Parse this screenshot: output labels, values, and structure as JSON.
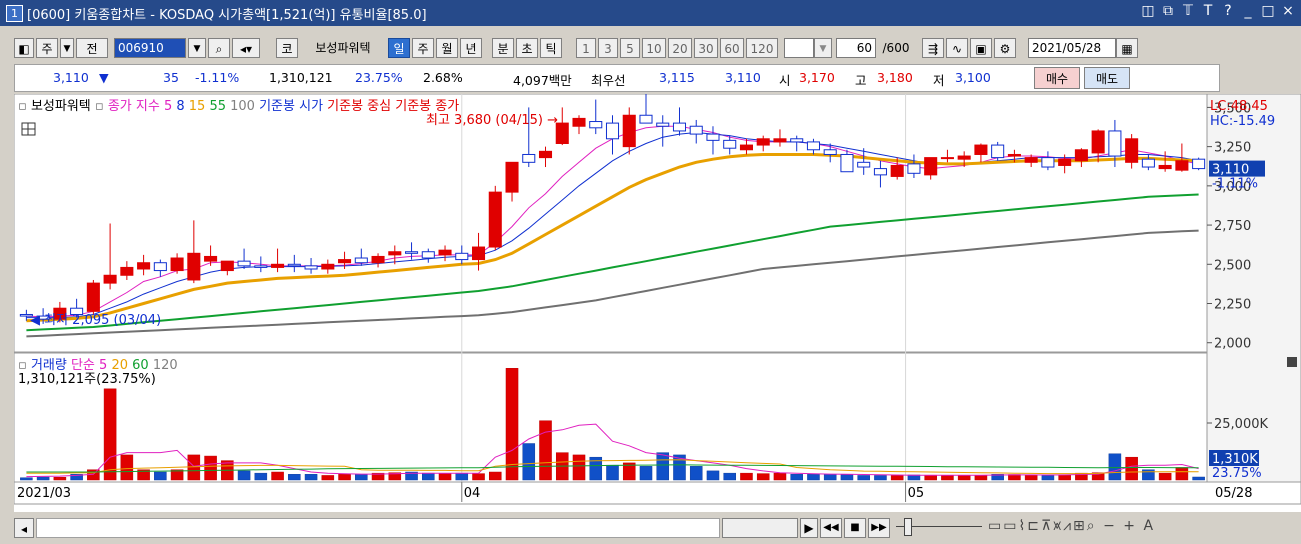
{
  "title": {
    "num": "1",
    "text": "[0600] 키움종합차트 - KOSDAQ 시가총액[1,521(억)] 유통비율[85.0]"
  },
  "window_controls": [
    "◫",
    "⧉",
    "𝕋",
    "T",
    "?",
    "_",
    "□",
    "×"
  ],
  "toolbar": {
    "ju": "주",
    "jeon": "전",
    "code": "006910",
    "ko": "코",
    "name": "보성파워텍",
    "period_buttons": [
      "일",
      "주",
      "월",
      "년",
      "분",
      "초",
      "틱"
    ],
    "num_buttons": [
      "1",
      "3",
      "5",
      "10",
      "20",
      "30",
      "60",
      "120"
    ],
    "count": "60",
    "total": "/600",
    "date": "2021/05/28"
  },
  "quote": {
    "price": "3,110",
    "arrow": "▼",
    "change": "35",
    "change_pct": "-1.11%",
    "volume": "1,310,121",
    "vol_ratio": "23.75%",
    "turnover": "2.68%",
    "amount": "4,097백만",
    "best_label": "최우선",
    "best_bid": "3,115",
    "best_ask": "3,110",
    "open_label": "시",
    "open": "3,170",
    "high_label": "고",
    "high": "3,180",
    "low_label": "저",
    "low": "3,100",
    "buy": "매수",
    "sell": "매도"
  },
  "chart_data": {
    "type": "candlestick",
    "legend_main": {
      "name": "보성파워텍",
      "items": [
        {
          "text": "종가 지수 5",
          "color": "#e020c0"
        },
        {
          "text": "8",
          "color": "#1030d0"
        },
        {
          "text": "15",
          "color": "#e8a000"
        },
        {
          "text": "55",
          "color": "#10a030"
        },
        {
          "text": "100",
          "color": "#808080"
        },
        {
          "text": "기준봉 시가",
          "color": "#1030d0"
        },
        {
          "text": "기준봉 중심",
          "color": "#e00000"
        },
        {
          "text": "기준봉 종가",
          "color": "#e00000"
        }
      ]
    },
    "y_ticks": [
      "3,500",
      "3,250",
      "3,000",
      "2,750",
      "2,500",
      "2,250",
      "2,000"
    ],
    "y_range": [
      1960,
      3560
    ],
    "lc": "LC:48.45",
    "hc": "HC:-15.49",
    "current_price": "3,110",
    "current_pct": "-1.11%",
    "high_annotation": "최고 3,680 (04/15) →",
    "low_annotation": "최저 2,095 (03/04)",
    "x_labels": [
      "2021/03",
      "04",
      "05",
      "05/28"
    ],
    "candles": [
      [
        2180,
        2210,
        2140,
        2170
      ],
      [
        2170,
        2220,
        2120,
        2150
      ],
      [
        2150,
        2260,
        2130,
        2220
      ],
      [
        2220,
        2280,
        2160,
        2180
      ],
      [
        2200,
        2400,
        2180,
        2380
      ],
      [
        2380,
        2760,
        2340,
        2430
      ],
      [
        2430,
        2520,
        2400,
        2480
      ],
      [
        2470,
        2560,
        2430,
        2510
      ],
      [
        2510,
        2530,
        2420,
        2460
      ],
      [
        2460,
        2570,
        2440,
        2540
      ],
      [
        2400,
        2780,
        2380,
        2570
      ],
      [
        2520,
        2620,
        2490,
        2550
      ],
      [
        2460,
        2520,
        2430,
        2520
      ],
      [
        2520,
        2600,
        2470,
        2490
      ],
      [
        2490,
        2550,
        2450,
        2480
      ],
      [
        2480,
        2600,
        2450,
        2500
      ],
      [
        2500,
        2560,
        2450,
        2490
      ],
      [
        2490,
        2540,
        2440,
        2470
      ],
      [
        2470,
        2530,
        2440,
        2500
      ],
      [
        2510,
        2580,
        2470,
        2530
      ],
      [
        2540,
        2600,
        2490,
        2510
      ],
      [
        2510,
        2570,
        2480,
        2550
      ],
      [
        2560,
        2620,
        2500,
        2580
      ],
      [
        2580,
        2640,
        2530,
        2570
      ],
      [
        2580,
        2600,
        2510,
        2540
      ],
      [
        2560,
        2620,
        2520,
        2590
      ],
      [
        2570,
        2620,
        2500,
        2530
      ],
      [
        2530,
        2700,
        2460,
        2610
      ],
      [
        2610,
        3000,
        2590,
        2960
      ],
      [
        2960,
        3150,
        2900,
        3150
      ],
      [
        3200,
        3500,
        3120,
        3150
      ],
      [
        3180,
        3250,
        3120,
        3220
      ],
      [
        3270,
        3500,
        3260,
        3400
      ],
      [
        3380,
        3450,
        3330,
        3430
      ],
      [
        3410,
        3550,
        3330,
        3370
      ],
      [
        3400,
        3450,
        3200,
        3300
      ],
      [
        3250,
        3500,
        3200,
        3450
      ],
      [
        3450,
        3600,
        3400,
        3400
      ],
      [
        3400,
        3450,
        3250,
        3380
      ],
      [
        3400,
        3500,
        3320,
        3350
      ],
      [
        3380,
        3420,
        3270,
        3330
      ],
      [
        3330,
        3380,
        3200,
        3290
      ],
      [
        3290,
        3320,
        3200,
        3240
      ],
      [
        3230,
        3300,
        3200,
        3260
      ],
      [
        3260,
        3320,
        3220,
        3300
      ],
      [
        3280,
        3360,
        3250,
        3300
      ],
      [
        3300,
        3320,
        3220,
        3280
      ],
      [
        3280,
        3300,
        3200,
        3230
      ],
      [
        3230,
        3270,
        3150,
        3200
      ],
      [
        3200,
        3230,
        3090,
        3090
      ],
      [
        3150,
        3240,
        3070,
        3120
      ],
      [
        3110,
        3160,
        2990,
        3070
      ],
      [
        3060,
        3180,
        3040,
        3130
      ],
      [
        3140,
        3200,
        3050,
        3080
      ],
      [
        3070,
        3180,
        3040,
        3180
      ],
      [
        3180,
        3230,
        3150,
        3180
      ],
      [
        3170,
        3220,
        3120,
        3190
      ],
      [
        3200,
        3270,
        3150,
        3260
      ],
      [
        3260,
        3280,
        3160,
        3180
      ],
      [
        3190,
        3230,
        3150,
        3200
      ],
      [
        3150,
        3200,
        3120,
        3180
      ],
      [
        3180,
        3220,
        3100,
        3120
      ],
      [
        3130,
        3200,
        3080,
        3170
      ],
      [
        3160,
        3240,
        3120,
        3230
      ],
      [
        3210,
        3360,
        3150,
        3350
      ],
      [
        3350,
        3420,
        3120,
        3190
      ],
      [
        3150,
        3330,
        3110,
        3300
      ],
      [
        3170,
        3200,
        3100,
        3120
      ],
      [
        3110,
        3220,
        3090,
        3130
      ],
      [
        3100,
        3270,
        3090,
        3160
      ],
      [
        3170,
        3180,
        3100,
        3110
      ]
    ],
    "ma_lines": [
      {
        "name": "5",
        "color": "#e020c0",
        "width": 1,
        "values": [
          2170,
          2165,
          2170,
          2175,
          2200,
          2260,
          2320,
          2390,
          2420,
          2460,
          2470,
          2510,
          2515,
          2510,
          2500,
          2490,
          2490,
          2490,
          2490,
          2495,
          2505,
          2520,
          2540,
          2550,
          2555,
          2560,
          2560,
          2560,
          2640,
          2740,
          2860,
          2950,
          3060,
          3150,
          3240,
          3300,
          3340,
          3370,
          3380,
          3380,
          3360,
          3340,
          3310,
          3290,
          3280,
          3280,
          3280,
          3270,
          3250,
          3220,
          3190,
          3160,
          3140,
          3120,
          3110,
          3120,
          3130,
          3150,
          3180,
          3190,
          3190,
          3185,
          3175,
          3170,
          3190,
          3210,
          3230,
          3210,
          3190,
          3160,
          3140
        ]
      },
      {
        "name": "8",
        "color": "#1030d0",
        "width": 1,
        "values": [
          2160,
          2160,
          2160,
          2165,
          2180,
          2220,
          2260,
          2310,
          2350,
          2390,
          2420,
          2450,
          2470,
          2480,
          2485,
          2485,
          2485,
          2485,
          2488,
          2490,
          2495,
          2505,
          2515,
          2525,
          2535,
          2545,
          2550,
          2555,
          2590,
          2650,
          2730,
          2820,
          2910,
          3000,
          3080,
          3160,
          3220,
          3270,
          3310,
          3330,
          3340,
          3330,
          3320,
          3300,
          3290,
          3280,
          3280,
          3270,
          3260,
          3240,
          3220,
          3200,
          3180,
          3160,
          3140,
          3140,
          3140,
          3150,
          3160,
          3170,
          3180,
          3180,
          3180,
          3180,
          3185,
          3190,
          3200,
          3200,
          3190,
          3180,
          3160
        ]
      },
      {
        "name": "15",
        "color": "#e8a000",
        "width": 3,
        "values": [
          2140,
          2145,
          2150,
          2155,
          2165,
          2190,
          2220,
          2250,
          2280,
          2310,
          2340,
          2360,
          2380,
          2390,
          2400,
          2410,
          2415,
          2420,
          2425,
          2430,
          2440,
          2450,
          2460,
          2470,
          2480,
          2490,
          2500,
          2505,
          2530,
          2570,
          2630,
          2690,
          2750,
          2810,
          2870,
          2930,
          2990,
          3040,
          3080,
          3120,
          3150,
          3170,
          3185,
          3195,
          3200,
          3200,
          3200,
          3200,
          3195,
          3190,
          3180,
          3170,
          3160,
          3150,
          3145,
          3140,
          3140,
          3145,
          3150,
          3155,
          3160,
          3160,
          3160,
          3160,
          3165,
          3170,
          3175,
          3175,
          3170,
          3165,
          3160
        ]
      },
      {
        "name": "55",
        "color": "#10a030",
        "width": 2,
        "values": [
          2080,
          2085,
          2090,
          2095,
          2100,
          2110,
          2120,
          2130,
          2140,
          2150,
          2160,
          2170,
          2180,
          2190,
          2200,
          2210,
          2220,
          2230,
          2240,
          2250,
          2260,
          2270,
          2280,
          2290,
          2300,
          2310,
          2320,
          2330,
          2345,
          2360,
          2380,
          2400,
          2420,
          2440,
          2460,
          2480,
          2500,
          2520,
          2540,
          2560,
          2580,
          2600,
          2620,
          2640,
          2660,
          2680,
          2700,
          2720,
          2740,
          2750,
          2760,
          2770,
          2780,
          2790,
          2800,
          2810,
          2820,
          2830,
          2840,
          2850,
          2860,
          2870,
          2880,
          2890,
          2900,
          2910,
          2920,
          2930,
          2935,
          2940,
          2945
        ]
      },
      {
        "name": "100",
        "color": "#707070",
        "width": 2,
        "values": [
          2040,
          2045,
          2050,
          2055,
          2060,
          2065,
          2070,
          2075,
          2080,
          2085,
          2090,
          2095,
          2100,
          2105,
          2110,
          2115,
          2120,
          2125,
          2130,
          2135,
          2140,
          2145,
          2150,
          2155,
          2160,
          2165,
          2170,
          2175,
          2185,
          2195,
          2210,
          2225,
          2240,
          2255,
          2270,
          2290,
          2310,
          2330,
          2350,
          2370,
          2390,
          2410,
          2430,
          2450,
          2470,
          2480,
          2490,
          2500,
          2510,
          2520,
          2530,
          2540,
          2550,
          2560,
          2570,
          2580,
          2590,
          2600,
          2610,
          2620,
          2630,
          2640,
          2650,
          2660,
          2670,
          2680,
          2690,
          2700,
          2705,
          2710,
          2715
        ]
      }
    ],
    "volume": {
      "legend": [
        {
          "text": "거래량",
          "color": "#1030d0"
        },
        {
          "text": "단순 5",
          "color": "#e020c0"
        },
        {
          "text": "20",
          "color": "#e8a000"
        },
        {
          "text": "60",
          "color": "#10a030"
        },
        {
          "text": "120",
          "color": "#808080"
        }
      ],
      "label": "1,310,121주(23.75%)",
      "y_tick": "25,000K",
      "current": "1,310K",
      "current_pct": "23.75%",
      "y_max": 50000,
      "values": [
        1000,
        1300,
        1200,
        2500,
        4500,
        40000,
        11000,
        4500,
        3500,
        4500,
        11000,
        10500,
        8500,
        4000,
        3000,
        3500,
        2500,
        2500,
        2000,
        2500,
        2500,
        3000,
        3200,
        3500,
        3000,
        2800,
        3000,
        2800,
        3500,
        49000,
        16000,
        26000,
        12000,
        11000,
        10000,
        6500,
        7500,
        6000,
        12000,
        11000,
        6000,
        4000,
        3000,
        3000,
        2800,
        3000,
        2500,
        2500,
        2500,
        2300,
        2000,
        2000,
        2000,
        2200,
        2100,
        2000,
        2000,
        2000,
        2500,
        2400,
        2300,
        2000,
        2300,
        3000,
        3200,
        11500,
        10000,
        4500,
        3000,
        5500,
        1310
      ],
      "ma5": [
        1500,
        1600,
        1700,
        2000,
        2500,
        10000,
        12000,
        12000,
        12000,
        13000,
        6000,
        7000,
        7500,
        7500,
        7500,
        6500,
        5000,
        3500,
        3000,
        2700,
        2600,
        2600,
        2700,
        3000,
        3000,
        3000,
        3000,
        3000,
        10000,
        13000,
        18000,
        21000,
        22000,
        24000,
        24500,
        17000,
        15000,
        12000,
        11000,
        9500,
        8500,
        7500,
        6500,
        5000,
        4000,
        3200,
        3000,
        2700,
        2600,
        2500,
        2400,
        2300,
        2200,
        2100,
        2100,
        2050,
        2050,
        2100,
        2200,
        2250,
        2250,
        2200,
        2250,
        2400,
        2600,
        4000,
        6000,
        6500,
        6500,
        6800,
        5000
      ],
      "ma20": [
        3000,
        3000,
        3000,
        3100,
        3200,
        4500,
        5000,
        5200,
        5400,
        5600,
        5800,
        6000,
        6200,
        6300,
        6400,
        6400,
        6300,
        6200,
        6100,
        6000,
        4500,
        4300,
        4300,
        4300,
        4200,
        4200,
        4100,
        4100,
        6000,
        6800,
        7200,
        7600,
        7900,
        8200,
        8400,
        8500,
        8600,
        8700,
        8800,
        8900,
        8500,
        8200,
        7900,
        7600,
        7300,
        7000,
        5500,
        5000,
        4500,
        4200,
        3900,
        3800,
        3700,
        3600,
        3500,
        3400,
        3300,
        3200,
        3100,
        3000,
        2900,
        2800,
        2800,
        2800,
        2900,
        3300,
        3500,
        3600,
        3600,
        3700,
        3600
      ],
      "ma60": [
        3500,
        3500,
        3500,
        3500,
        3500,
        3600,
        3700,
        3800,
        3900,
        4000,
        4100,
        4200,
        4300,
        4400,
        4500,
        4600,
        4700,
        4800,
        4900,
        5000,
        5050,
        5100,
        5150,
        5200,
        5250,
        5300,
        5350,
        5400,
        5600,
        5800,
        5900,
        6000,
        6100,
        6200,
        6300,
        6400,
        6500,
        6550,
        6600,
        6650,
        6600,
        6550,
        6500,
        6450,
        6400,
        6350,
        6300,
        6250,
        6200,
        6150,
        6100,
        6050,
        6000,
        5950,
        5900,
        5850,
        5800,
        5750,
        5700,
        5650,
        5600,
        5550,
        5500,
        5450,
        5400,
        5450,
        5500,
        5500,
        5450,
        5400,
        5350
      ]
    }
  },
  "status": {
    "nav": [
      "▶",
      "◀◀",
      "■",
      "▶▶"
    ]
  }
}
